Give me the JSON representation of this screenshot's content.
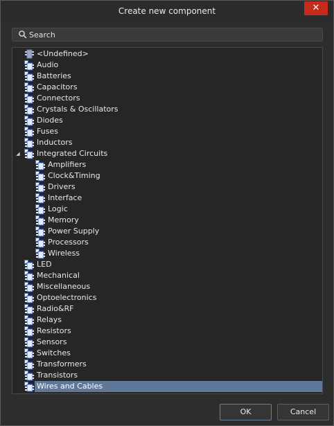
{
  "window": {
    "title": "Create new component",
    "close_label": "✕"
  },
  "search": {
    "placeholder": "Search",
    "value": ""
  },
  "tree": {
    "items": [
      {
        "label": "<Undefined>",
        "level": 0,
        "icon": "undefined-component-icon",
        "expanded": null,
        "selected": false
      },
      {
        "label": "Audio",
        "level": 0,
        "icon": "component-type-icon",
        "expanded": null,
        "selected": false
      },
      {
        "label": "Batteries",
        "level": 0,
        "icon": "component-type-icon",
        "expanded": null,
        "selected": false
      },
      {
        "label": "Capacitors",
        "level": 0,
        "icon": "component-type-icon",
        "expanded": null,
        "selected": false
      },
      {
        "label": "Connectors",
        "level": 0,
        "icon": "component-type-icon",
        "expanded": null,
        "selected": false
      },
      {
        "label": "Crystals & Oscillators",
        "level": 0,
        "icon": "component-type-icon",
        "expanded": null,
        "selected": false
      },
      {
        "label": "Diodes",
        "level": 0,
        "icon": "component-type-icon",
        "expanded": null,
        "selected": false
      },
      {
        "label": "Fuses",
        "level": 0,
        "icon": "component-type-icon",
        "expanded": null,
        "selected": false
      },
      {
        "label": "Inductors",
        "level": 0,
        "icon": "component-type-icon",
        "expanded": null,
        "selected": false
      },
      {
        "label": "Integrated Circuits",
        "level": 0,
        "icon": "component-type-icon",
        "expanded": true,
        "selected": false
      },
      {
        "label": "Amplifiers",
        "level": 1,
        "icon": "component-type-icon",
        "expanded": null,
        "selected": false
      },
      {
        "label": "Clock&Timing",
        "level": 1,
        "icon": "component-type-icon",
        "expanded": null,
        "selected": false
      },
      {
        "label": "Drivers",
        "level": 1,
        "icon": "component-type-icon",
        "expanded": null,
        "selected": false
      },
      {
        "label": "Interface",
        "level": 1,
        "icon": "component-type-icon",
        "expanded": null,
        "selected": false
      },
      {
        "label": "Logic",
        "level": 1,
        "icon": "component-type-icon",
        "expanded": null,
        "selected": false
      },
      {
        "label": "Memory",
        "level": 1,
        "icon": "component-type-icon",
        "expanded": null,
        "selected": false
      },
      {
        "label": "Power Supply",
        "level": 1,
        "icon": "component-type-icon",
        "expanded": null,
        "selected": false
      },
      {
        "label": "Processors",
        "level": 1,
        "icon": "component-type-icon",
        "expanded": null,
        "selected": false
      },
      {
        "label": "Wireless",
        "level": 1,
        "icon": "component-type-icon",
        "expanded": null,
        "selected": false
      },
      {
        "label": "LED",
        "level": 0,
        "icon": "component-type-icon",
        "expanded": null,
        "selected": false
      },
      {
        "label": "Mechanical",
        "level": 0,
        "icon": "component-type-icon",
        "expanded": null,
        "selected": false
      },
      {
        "label": "Miscellaneous",
        "level": 0,
        "icon": "component-type-icon",
        "expanded": null,
        "selected": false
      },
      {
        "label": "Optoelectronics",
        "level": 0,
        "icon": "component-type-icon",
        "expanded": null,
        "selected": false
      },
      {
        "label": "Radio&RF",
        "level": 0,
        "icon": "component-type-icon",
        "expanded": null,
        "selected": false
      },
      {
        "label": "Relays",
        "level": 0,
        "icon": "component-type-icon",
        "expanded": null,
        "selected": false
      },
      {
        "label": "Resistors",
        "level": 0,
        "icon": "component-type-icon",
        "expanded": null,
        "selected": false
      },
      {
        "label": "Sensors",
        "level": 0,
        "icon": "component-type-icon",
        "expanded": null,
        "selected": false
      },
      {
        "label": "Switches",
        "level": 0,
        "icon": "component-type-icon",
        "expanded": null,
        "selected": false
      },
      {
        "label": "Transformers",
        "level": 0,
        "icon": "component-type-icon",
        "expanded": null,
        "selected": false
      },
      {
        "label": "Transistors",
        "level": 0,
        "icon": "component-type-icon",
        "expanded": null,
        "selected": false
      },
      {
        "label": "Wires and Cables",
        "level": 0,
        "icon": "component-type-icon",
        "expanded": null,
        "selected": true
      }
    ]
  },
  "buttons": {
    "ok_label": "OK",
    "cancel_label": "Cancel"
  },
  "colors": {
    "accent": "#c42b1c",
    "selection": "#607898",
    "background": "#2d2d2d"
  }
}
